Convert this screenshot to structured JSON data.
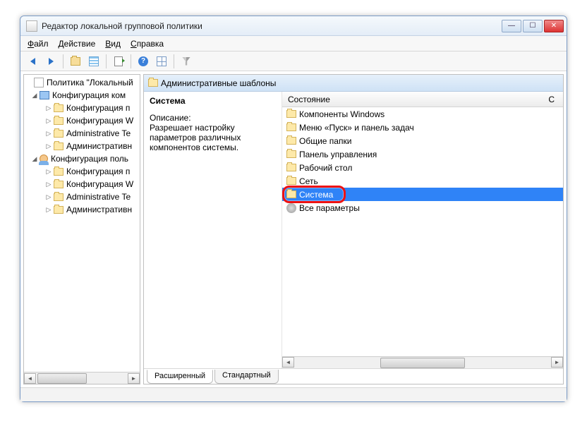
{
  "window": {
    "title": "Редактор локальной групповой политики"
  },
  "menu": {
    "file": "Файл",
    "action": "Действие",
    "view": "Вид",
    "help": "Справка"
  },
  "tree": {
    "root": "Политика \"Локальный",
    "computer": "Конфигурация ком",
    "comp_children": [
      "Конфигурация п",
      "Конфигурация W",
      "Administrative Te",
      "Административн"
    ],
    "user": "Конфигурация поль",
    "user_children": [
      "Конфигурация п",
      "Конфигурация W",
      "Administrative Te",
      "Административн"
    ]
  },
  "pane": {
    "header": "Административные шаблоны",
    "section_title": "Система",
    "desc_label": "Описание:",
    "desc_text": "Разрешает настройку параметров различных компонентов системы.",
    "column_state": "Состояние",
    "column_c": "С",
    "items": [
      "Компоненты Windows",
      "Меню «Пуск» и панель задач",
      "Общие папки",
      "Панель управления",
      "Рабочий стол",
      "Сеть",
      "Система",
      "Все параметры"
    ],
    "selected_index": 6,
    "tabs": {
      "extended": "Расширенный",
      "standard": "Стандартный"
    }
  }
}
